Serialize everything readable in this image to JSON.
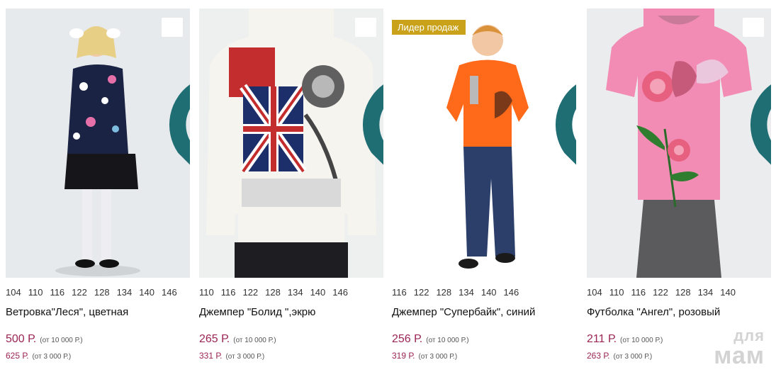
{
  "colors": {
    "accent": "#9b2453",
    "badge": "#c9a21a",
    "heart": "#1f6e74"
  },
  "products": [
    {
      "sizes": [
        "104",
        "110",
        "116",
        "122",
        "128",
        "134",
        "140",
        "146"
      ],
      "title": "Ветровка\"Леся\", цветная",
      "price": "500 Р.",
      "price_note": "(от 10 000 Р.)",
      "price2": "625 Р.",
      "price2_note": "(от 3 000 Р.)",
      "icon": "heart-icon"
    },
    {
      "sizes": [
        "110",
        "116",
        "122",
        "128",
        "134",
        "140",
        "146"
      ],
      "title": "Джемпер \"Болид \",экрю",
      "price": "265 Р.",
      "price_note": "(от 10 000 Р.)",
      "price2": "331 Р.",
      "price2_note": "(от 3 000 Р.)",
      "icon": "heart-icon"
    },
    {
      "badge": "Лидер продаж",
      "sizes": [
        "116",
        "122",
        "128",
        "134",
        "140",
        "146"
      ],
      "title": "Джемпер \"Супербайк\", синий",
      "price": "256 Р.",
      "price_note": "(от 10 000 Р.)",
      "price2": "319 Р.",
      "price2_note": "(от 3 000 Р.)",
      "icon": "heart-icon"
    },
    {
      "sizes": [
        "104",
        "110",
        "116",
        "122",
        "128",
        "134",
        "140"
      ],
      "title": "Футболка \"Ангел\", розовый",
      "price": "211 Р.",
      "price_note": "(от 10 000 Р.)",
      "price2": "263 Р.",
      "price2_note": "(от 3 000 Р.)",
      "icon": "heart-icon"
    }
  ],
  "watermark": {
    "line1": "для",
    "line2": "мам"
  }
}
